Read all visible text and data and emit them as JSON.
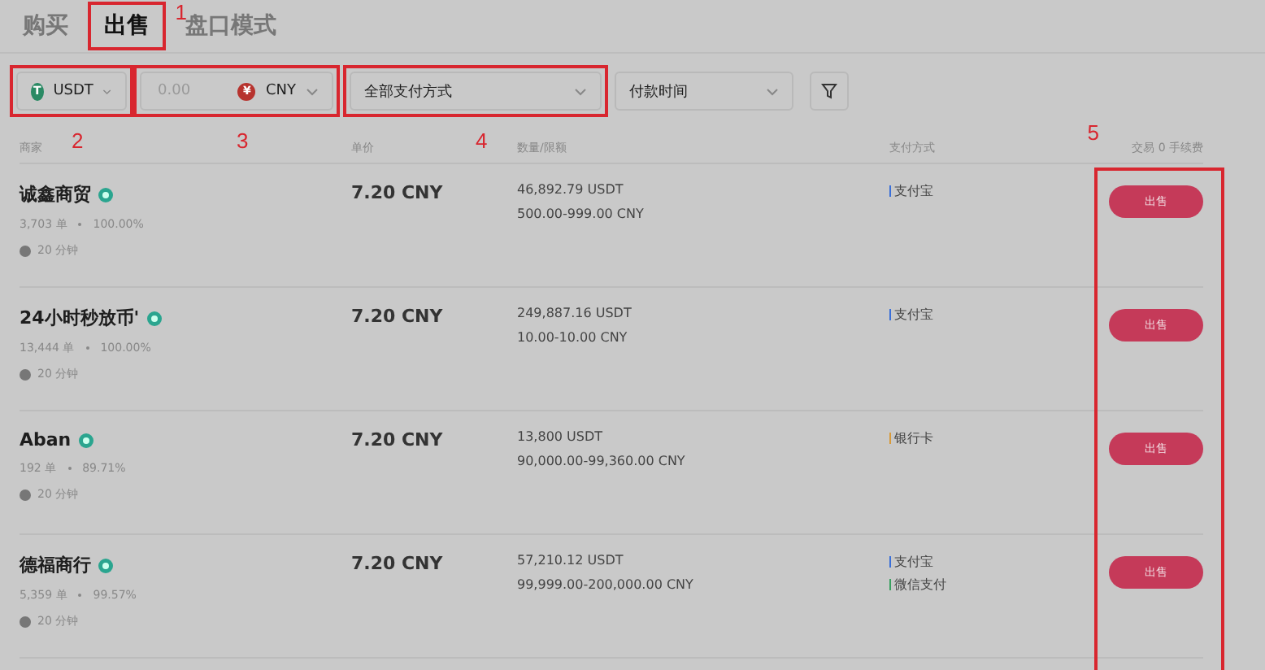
{
  "tabs": [
    {
      "label": "购买",
      "selected": false
    },
    {
      "label": "出售",
      "selected": true,
      "annotation": {
        "number": "1"
      }
    },
    {
      "label": "盘口模式",
      "selected": false
    }
  ],
  "filters": {
    "coin": {
      "value": "USDT",
      "icon": "T",
      "annotation": {
        "number": "2"
      }
    },
    "amount": {
      "placeholder": "0.00",
      "currency": "CNY",
      "currency_icon": "¥",
      "annotation": {
        "number": "3"
      }
    },
    "payment": {
      "value": "全部支付方式",
      "annotation": {
        "number": "4"
      }
    },
    "time": {
      "value": "付款时间"
    }
  },
  "table": {
    "columns": [
      "商家",
      "单价",
      "数量/限额",
      "支付方式",
      "交易 0 手续费"
    ],
    "action_annotation": {
      "number": "5"
    },
    "rows": [
      {
        "merchant": "诚鑫商贸",
        "verified": true,
        "orders": "3,703 单",
        "rate": "100.00%",
        "time": "20 分钟",
        "price": "7.20 CNY",
        "quantity": "46,892.79 USDT",
        "limit": "500.00-999.00 CNY",
        "payments": [
          {
            "name": "支付宝",
            "color": "#3a6fd8"
          }
        ],
        "action": "出售"
      },
      {
        "merchant": "24小时秒放币'",
        "verified": true,
        "orders": "13,444 单",
        "rate": "100.00%",
        "time": "20 分钟",
        "price": "7.20 CNY",
        "quantity": "249,887.16 USDT",
        "limit": "10.00-10.00 CNY",
        "payments": [
          {
            "name": "支付宝",
            "color": "#3a6fd8"
          }
        ],
        "action": "出售"
      },
      {
        "merchant": "Aban",
        "verified": true,
        "orders": "192 单",
        "rate": "89.71%",
        "time": "20 分钟",
        "price": "7.20 CNY",
        "quantity": "13,800 USDT",
        "limit": "90,000.00-99,360.00 CNY",
        "payments": [
          {
            "name": "银行卡",
            "color": "#d89a3a"
          }
        ],
        "action": "出售"
      },
      {
        "merchant": "德福商行",
        "verified": true,
        "orders": "5,359 单",
        "rate": "99.57%",
        "time": "20 分钟",
        "price": "7.20 CNY",
        "quantity": "57,210.12 USDT",
        "limit": "99,999.00-200,000.00 CNY",
        "payments": [
          {
            "name": "支付宝",
            "color": "#3a6fd8"
          },
          {
            "name": "微信支付",
            "color": "#3aa060"
          }
        ],
        "action": "出售"
      }
    ]
  }
}
